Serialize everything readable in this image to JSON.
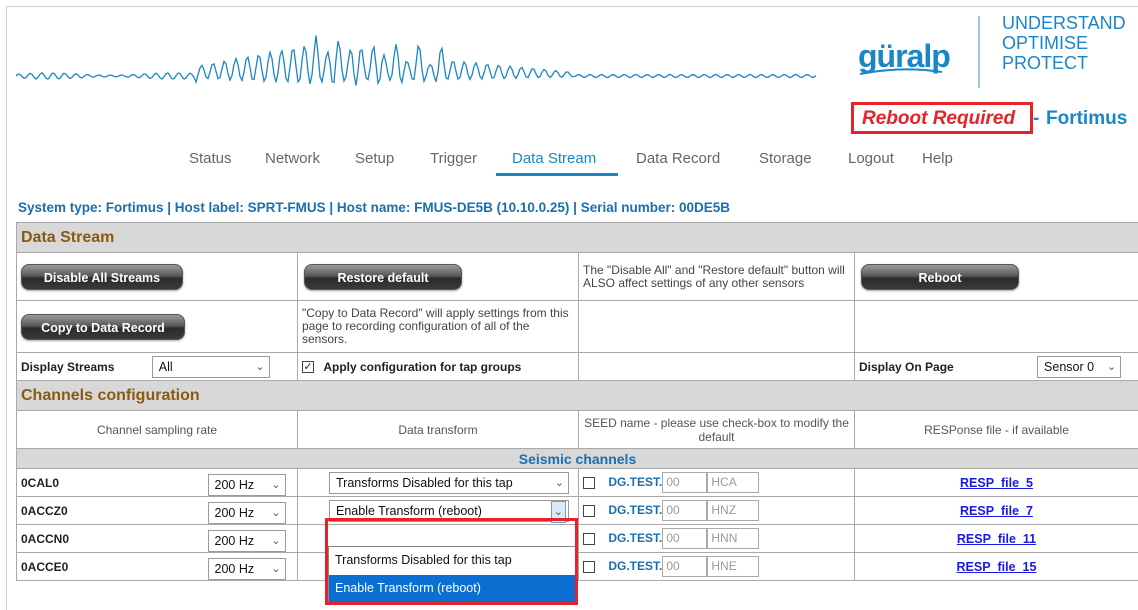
{
  "header": {
    "brand_word": "güralp",
    "tagline": [
      "UNDERSTAND",
      "OPTIMISE",
      "PROTECT"
    ],
    "reboot_notice": "Reboot Required",
    "separator": "-",
    "device": "Fortimus"
  },
  "nav": {
    "items": [
      "Status",
      "Network",
      "Setup",
      "Trigger",
      "Data Stream",
      "Data Record",
      "Storage",
      "Logout",
      "Help"
    ],
    "active": "Data Stream"
  },
  "system_info": "System type: Fortimus | Host label: SPRT-FMUS | Host name: FMUS-DE5B (10.10.0.25) | Serial number: 00DE5B",
  "data_stream": {
    "title": "Data Stream",
    "disable_all_label": "Disable All Streams",
    "restore_default_label": "Restore default",
    "disable_restore_note": "The \"Disable All\" and \"Restore default\" button will ALSO affect settings of any other sensors",
    "reboot_label": "Reboot",
    "copy_label": "Copy to Data Record",
    "copy_note": "\"Copy to Data Record\" will apply settings from this page to recording configuration of all of the sensors.",
    "display_streams_label": "Display Streams",
    "display_streams_value": "All",
    "apply_tap_groups_label": "Apply configuration for tap groups",
    "apply_tap_groups_checked": true,
    "display_on_page_label": "Display On Page",
    "display_on_page_value": "Sensor 0"
  },
  "channels": {
    "title": "Channels configuration",
    "col_rate": "Channel sampling rate",
    "col_transform": "Data transform",
    "col_seed": "SEED name - please use check-box to modify the default",
    "col_resp": "RESPonse file - if available",
    "group": "Seismic channels",
    "rows": [
      {
        "name": "0CAL0",
        "rate": "200 Hz",
        "transform": "Transforms Disabled for this tap",
        "seed_prefix": "DG.TEST.",
        "loc": "00",
        "chan": "HCA",
        "resp": "RESP_file_5"
      },
      {
        "name": "0ACCZ0",
        "rate": "200 Hz",
        "transform": "Enable Transform (reboot)",
        "seed_prefix": "DG.TEST.",
        "loc": "00",
        "chan": "HNZ",
        "resp": "RESP_file_7"
      },
      {
        "name": "0ACCN0",
        "rate": "200 Hz",
        "transform": "",
        "seed_prefix": "DG.TEST.",
        "loc": "00",
        "chan": "HNN",
        "resp": "RESP_file_11"
      },
      {
        "name": "0ACCE0",
        "rate": "200 Hz",
        "transform": "",
        "seed_prefix": "DG.TEST.",
        "loc": "00",
        "chan": "HNE",
        "resp": "RESP_file_15"
      }
    ]
  },
  "transform_dropdown": {
    "options": [
      "Transforms Disabled for this tap",
      "Enable Transform (reboot)"
    ],
    "highlighted": "Enable Transform (reboot)"
  },
  "colors": {
    "accent": "#1a86c8",
    "alert": "#e4232a",
    "section_title": "#8a5a12",
    "selected_option": "#0b6fd1"
  },
  "icons": {
    "dropdown": "chevron-down-icon",
    "checkbox": "checkbox-icon"
  }
}
